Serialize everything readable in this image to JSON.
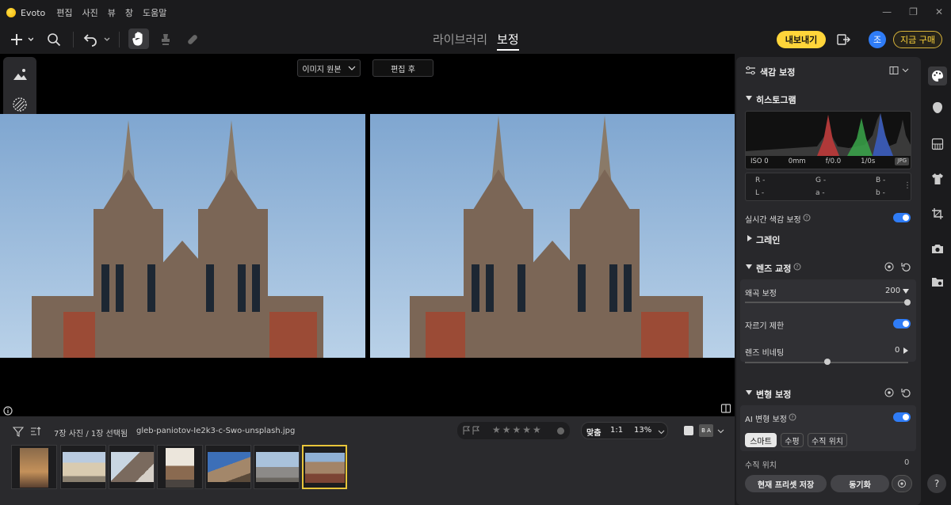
{
  "app": {
    "name": "Evoto",
    "menus": [
      "편집",
      "사진",
      "뷰",
      "창",
      "도움말"
    ],
    "window_controls": [
      "—",
      "❐",
      "✕"
    ]
  },
  "toolbar": {
    "tabs": [
      "라이브러리",
      "보정"
    ],
    "export_label": "내보내기",
    "avatar_letter": "조",
    "buy_label": "지금 구매"
  },
  "canvas": {
    "view_select": "이미지 원본",
    "after_label": "편집 후"
  },
  "film": {
    "count_text": "7장 사진 / 1장 선택됨",
    "filename": "gleb-paniotov-Ie2k3-c-Swo-unsplash.jpg",
    "fit_label": "맞춤",
    "one_to_one": "1:1",
    "zoom": "13%",
    "ba_label": "B A"
  },
  "panel": {
    "title": "색감 보정",
    "histogram_label": "히스토그램",
    "exif": {
      "iso": "ISO 0",
      "focal": "0mm",
      "aperture": "f/0.0",
      "shutter": "1/0s",
      "format": "JPG"
    },
    "rgb": {
      "r": "R -",
      "g": "G -",
      "b": "B -",
      "l": "L -",
      "a": "a -",
      "bb": "b -"
    },
    "realtime_label": "실시간 색감 보정",
    "grain_label": "그레인",
    "lens_label": "렌즈 교정",
    "distortion_label": "왜곡 보정",
    "distortion_value": "200",
    "crop_label": "자르기 제한",
    "vignette_label": "렌즈 비네팅",
    "vignette_value": "0",
    "transform_label": "변형 보정",
    "ai_transform_label": "AI 변형 보정",
    "chips": [
      "스마트",
      "수평",
      "수직 위치"
    ],
    "vertical_label": "수직 위치",
    "vertical_value": "0",
    "save_preset": "현재 프리셋 저장",
    "sync": "동기화"
  },
  "colors": {
    "accent": "#2f7cf6",
    "yellow": "#ffd53a"
  }
}
